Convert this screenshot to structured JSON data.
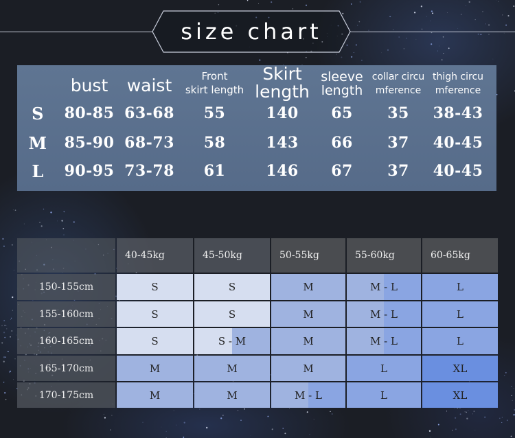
{
  "title": "size chart",
  "measurements": {
    "headers": [
      {
        "label": "",
        "lines": []
      },
      {
        "label": "bust",
        "lines": [
          "bust"
        ]
      },
      {
        "label": "waist",
        "lines": [
          "waist"
        ]
      },
      {
        "label": "Front skirt length",
        "lines": [
          "Front",
          "skirt length"
        ]
      },
      {
        "label": "Skirt length",
        "lines": [
          "Skirt",
          "length"
        ]
      },
      {
        "label": "sleeve length",
        "lines": [
          "sleeve",
          "length"
        ]
      },
      {
        "label": "collar circumference",
        "lines": [
          "collar circu",
          "mference"
        ]
      },
      {
        "label": "thigh circumference",
        "lines": [
          "thigh circu",
          "mference"
        ]
      }
    ],
    "rows": [
      {
        "size": "S",
        "values": [
          "80-85",
          "63-68",
          "55",
          "140",
          "65",
          "35",
          "38-43"
        ]
      },
      {
        "size": "M",
        "values": [
          "85-90",
          "68-73",
          "58",
          "143",
          "66",
          "37",
          "40-45"
        ]
      },
      {
        "size": "L",
        "values": [
          "90-95",
          "73-78",
          "61",
          "146",
          "67",
          "37",
          "40-45"
        ]
      }
    ]
  },
  "size_guide": {
    "weights": [
      "40-45kg",
      "45-50kg",
      "50-55kg",
      "55-60kg",
      "60-65kg"
    ],
    "heights": [
      "150-155cm",
      "155-160cm",
      "160-165cm",
      "165-170cm",
      "170-175cm"
    ],
    "cells": [
      [
        "S",
        "S",
        "M",
        "M - L",
        "L"
      ],
      [
        "S",
        "S",
        "M",
        "M - L",
        "L"
      ],
      [
        "S",
        "S - M",
        "M",
        "M - L",
        "L"
      ],
      [
        "M",
        "M",
        "M",
        "L",
        "XL"
      ],
      [
        "M",
        "M",
        "M - L",
        "L",
        "XL"
      ]
    ]
  },
  "colors": {
    "background": "#1b1e25",
    "measure_panel": "#5b7090",
    "guide_header": "#4a4c50",
    "size_S": "#d6def0",
    "size_M": "#9fb3e0",
    "size_L": "#8aa5e2",
    "size_XL": "#6a8fe0"
  }
}
